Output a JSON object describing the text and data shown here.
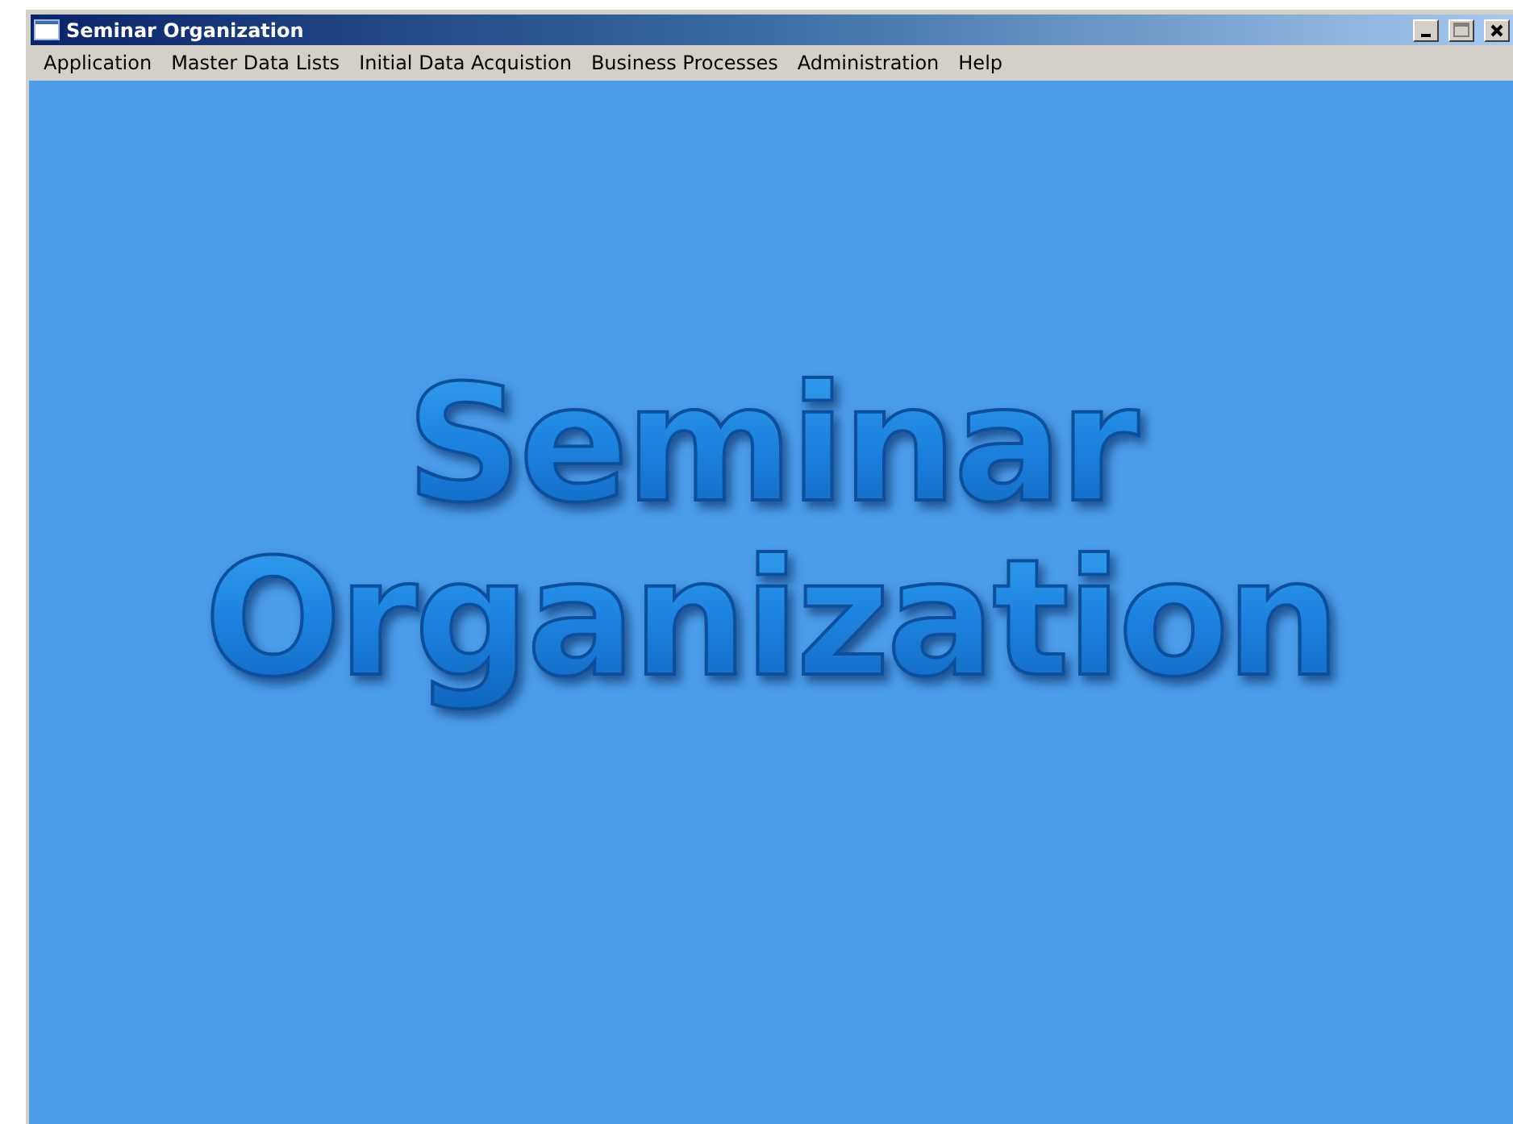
{
  "window": {
    "title": "Seminar Organization"
  },
  "menu": [
    "Application",
    "Master Data Lists",
    "Initial Data Acquistion",
    "Business Processes",
    "Administration",
    "Help"
  ],
  "splash": {
    "lines": [
      "Seminar",
      "Organization"
    ]
  }
}
